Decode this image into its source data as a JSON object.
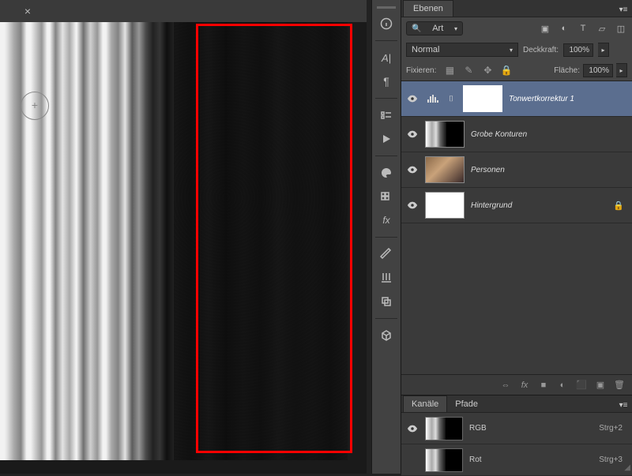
{
  "panels": {
    "layers_tab": "Ebenen",
    "channels_tab": "Kanäle",
    "paths_tab": "Pfade"
  },
  "filter": {
    "label": "Art"
  },
  "blend": {
    "mode": "Normal",
    "opacity_label": "Deckkraft:",
    "opacity_value": "100%",
    "fill_label": "Fläche:",
    "fill_value": "100%"
  },
  "lock": {
    "label": "Fixieren:"
  },
  "layers": [
    {
      "name": "Tonwertkorrektur 1"
    },
    {
      "name": "Grobe Konturen"
    },
    {
      "name": "Personen"
    },
    {
      "name": "Hintergrund"
    }
  ],
  "channels": [
    {
      "name": "RGB",
      "shortcut": "Strg+2"
    },
    {
      "name": "Rot",
      "shortcut": "Strg+3"
    }
  ],
  "footer_icons": {
    "link": "⇔",
    "fx": "fx",
    "mask": "■",
    "adjust": "◐",
    "folder": "⬛",
    "new": "▣",
    "trash": "🗑"
  }
}
